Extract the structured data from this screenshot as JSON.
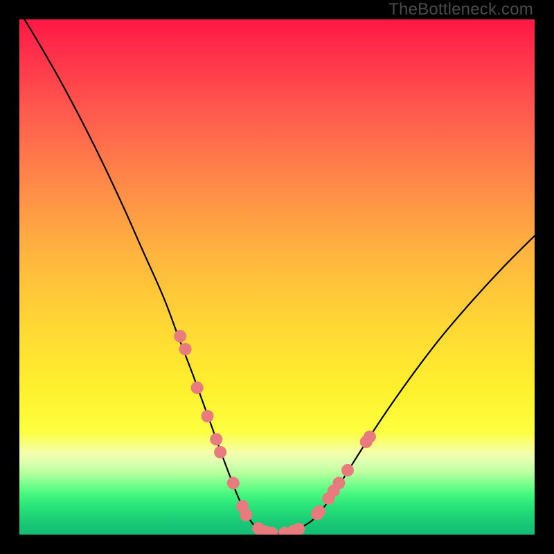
{
  "watermark": "TheBottleneck.com",
  "chart_data": {
    "type": "line",
    "title": "",
    "xlabel": "",
    "ylabel": "",
    "xlim": [
      0,
      100
    ],
    "ylim": [
      0,
      100
    ],
    "series": [
      {
        "name": "bottleneck-curve",
        "x": [
          1,
          4,
          8,
          12,
          16,
          20,
          24,
          28,
          31,
          33.5,
          35.5,
          37.5,
          39.3,
          41,
          42.5,
          44,
          45.3,
          46.7,
          48,
          51,
          54,
          56.5,
          58,
          60,
          62,
          64.5,
          68,
          72,
          77,
          82,
          88,
          94,
          100
        ],
        "y": [
          100,
          95,
          88,
          80.5,
          72.5,
          64,
          55,
          46,
          38,
          31.5,
          26,
          20.5,
          15.5,
          11,
          7.2,
          4.2,
          2.1,
          0.9,
          0.3,
          0.3,
          1.1,
          2.5,
          4,
          6.5,
          9.5,
          13.5,
          19,
          25,
          32,
          38.5,
          45.5,
          52,
          58
        ]
      }
    ],
    "markers": {
      "name": "highlight-dots",
      "color": "#e97a7e",
      "radius_px": 9,
      "points_xy": [
        [
          31.2,
          38.5
        ],
        [
          32.2,
          36.0
        ],
        [
          34.5,
          28.5
        ],
        [
          36.5,
          23.0
        ],
        [
          38.2,
          18.5
        ],
        [
          39.0,
          16.0
        ],
        [
          41.5,
          10.0
        ],
        [
          43.3,
          5.5
        ],
        [
          44.0,
          3.8
        ],
        [
          46.4,
          1.2
        ],
        [
          47.7,
          0.6
        ],
        [
          49.0,
          0.3
        ],
        [
          51.5,
          0.3
        ],
        [
          53.2,
          0.7
        ],
        [
          54.2,
          1.1
        ],
        [
          57.8,
          4.0
        ],
        [
          58.2,
          4.5
        ],
        [
          60.0,
          7.0
        ],
        [
          61.0,
          8.5
        ],
        [
          62.0,
          10.0
        ],
        [
          63.7,
          12.5
        ],
        [
          67.3,
          18.0
        ],
        [
          68.0,
          19.0
        ]
      ]
    }
  }
}
